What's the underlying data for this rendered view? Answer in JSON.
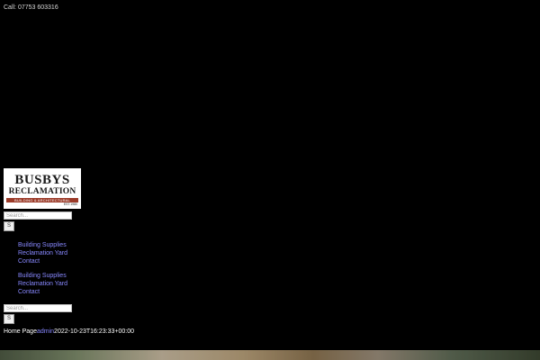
{
  "topbar": {
    "call": "Call: 07753 603316"
  },
  "logo": {
    "line1": "BUSBYS",
    "line2": "RECLAMATION",
    "strip": "BUILDING & ARCHITECTURAL",
    "est": "EST.1980"
  },
  "search_form_1": {
    "placeholder": "Search...",
    "button_label": "S"
  },
  "menu_1": [
    "Building Supplies",
    "Reclamation Yard",
    "Contact"
  ],
  "menu_2": [
    "Building Supplies",
    "Reclamation Yard",
    "Contact"
  ],
  "search_form_2": {
    "placeholder": "Search...",
    "button_label": "S"
  },
  "post_meta": {
    "home_page": "Home Page",
    "author": "admin",
    "datetime": "2022-10-23T16:23:33+00:00"
  }
}
